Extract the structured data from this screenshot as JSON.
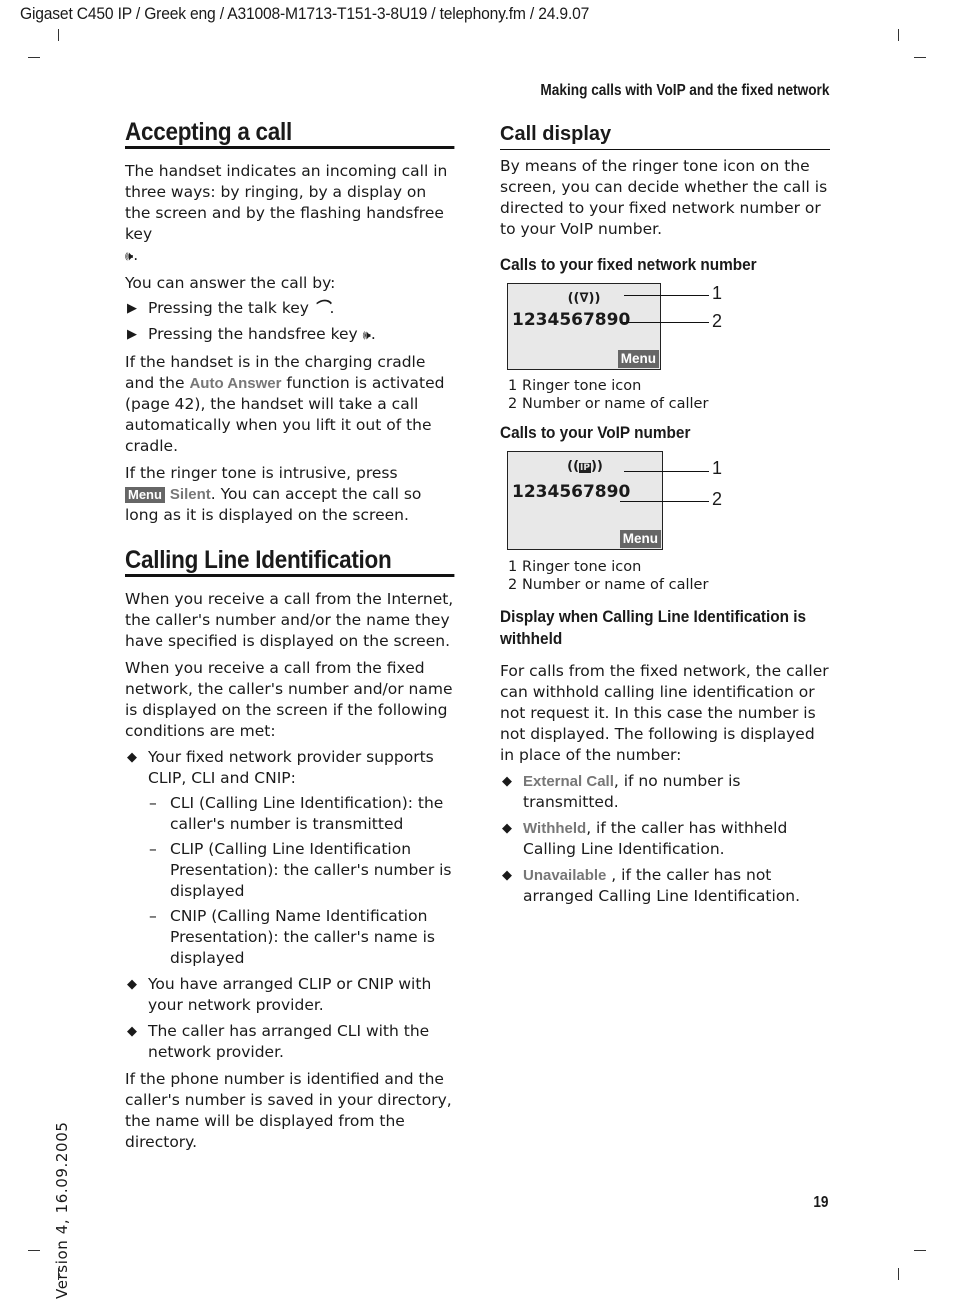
{
  "header": {
    "file_info": "Gigaset C450 IP / Greek eng / A31008-M1713-T151-3-8U19 / telephony.fm / 24.9.07",
    "running_title": "Making calls with VoIP and the fixed network"
  },
  "left": {
    "accepting": {
      "title": "Accepting a call",
      "intro": "The handset indicates an incoming call in three ways: by ringing, by a display on the screen and by the flashing handsfree key",
      "answer_intro": "You can answer the call by:",
      "steps": [
        {
          "text": "Pressing the talk key",
          "icon": "talk-key-icon"
        },
        {
          "text": "Pressing the handsfree key",
          "icon": "handsfree-key-icon"
        }
      ],
      "auto_answer_pre": "If the handset is in the charging cradle and the",
      "auto_answer_ui": "Auto Answer",
      "auto_answer_post": "function is activated (page 42), the handset will take a call automatically when you lift it out of the cradle.",
      "silent_pre": "If the ringer tone is intrusive, press",
      "silent_menu": "Menu",
      "silent_ui": "Silent",
      "silent_post": ". You can accept the call so long as it is displayed on the screen."
    },
    "cli": {
      "title": "Calling Line Identification",
      "p1": "When you receive a call from the Internet, the caller's number and/or the name they have specified is displayed on the screen.",
      "p2": "When you receive a call from the fixed network, the caller's number and/or name is displayed on the screen if the following conditions are met:",
      "bullets": [
        {
          "text": "Your fixed network provider supports CLIP, CLI and CNIP:"
        },
        {
          "text": "You have arranged CLIP or CNIP with your network provider."
        },
        {
          "text": "The caller has arranged CLI with the network provider."
        }
      ],
      "subitems": [
        "CLI (Calling Line Identification): the caller's number is transmitted",
        "CLIP (Calling Line Identification Presentation): the caller's number is displayed",
        "CNIP (Calling Name Identification Presentation): the caller's name is displayed"
      ],
      "p3": "If the phone number is identified and the caller's number is saved in your directory, the name will be displayed from the directory."
    }
  },
  "right": {
    "call_display": {
      "title": "Call display",
      "intro": "By means of the ringer tone icon on the screen, you can decide whether the call is directed to your fixed network number or to your VoIP number.",
      "fixed": {
        "heading": "Calls to your fixed network number",
        "ringer": "((∇))",
        "number": "1234567890",
        "menu": "Menu",
        "callouts": [
          "1",
          "2"
        ],
        "legend": [
          {
            "n": "1",
            "text": "Ringer tone icon"
          },
          {
            "n": "2",
            "text": "Number or name of caller"
          }
        ]
      },
      "voip": {
        "heading": "Calls to your VoIP number",
        "ringer_left": "((",
        "ringer_ip": "IP",
        "ringer_right": "))",
        "number": "1234567890",
        "menu": "Menu",
        "callouts": [
          "1",
          "2"
        ],
        "legend": [
          {
            "n": "1",
            "text": "Ringer tone icon"
          },
          {
            "n": "2",
            "text": "Number or name of caller"
          }
        ]
      }
    },
    "withheld": {
      "heading": "Display when Calling Line Identification is withheld",
      "intro": "For calls from the fixed network, the caller can withhold calling line identification or not request it. In this case the number is not displayed. The following is displayed in place of the number:",
      "items": [
        {
          "ui": "External Call",
          "text": ", if no number is transmitted."
        },
        {
          "ui": "Withheld",
          "text": ", if the caller has withheld Calling Line Identification."
        },
        {
          "ui": "Unavailable",
          "text": " , if the caller has not arranged Calling Line Identification."
        }
      ]
    }
  },
  "footer": {
    "version": "Version 4, 16.09.2005",
    "page_number": "19"
  }
}
